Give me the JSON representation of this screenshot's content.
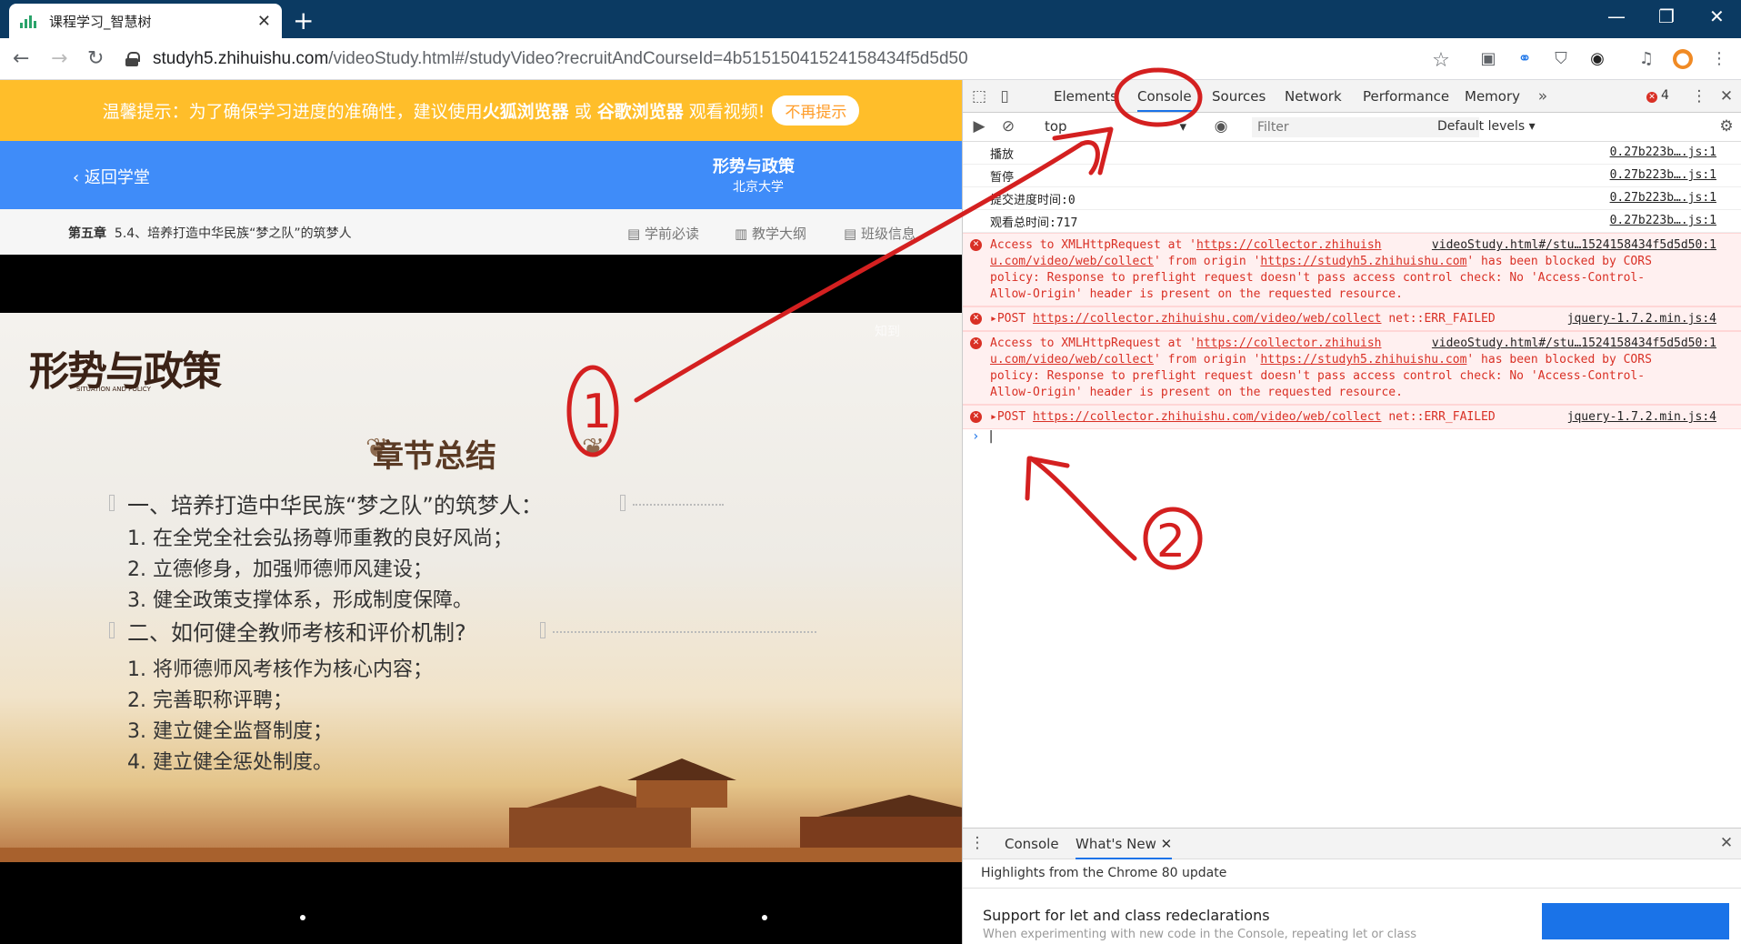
{
  "browser": {
    "tab_title": "课程学习_智慧树",
    "url_host": "studyh5.zhihuishu.com",
    "url_path": "/videoStudy.html#/studyVideo?recruitAndCourseId=4b51515041524158434f5d5d50"
  },
  "notice": {
    "text_prefix": "温馨提示：为了确保学习进度的准确性，建议使用",
    "browser1": "火狐浏览器",
    "or": "或",
    "browser2": "谷歌浏览器",
    "suffix": "观看视频!",
    "dismiss": "不再提示"
  },
  "course": {
    "back": "返回学堂",
    "title": "形势与政策",
    "university": "北京大学"
  },
  "chapter": {
    "label": "第五章",
    "text": "5.4、培养打造中华民族“梦之队”的筑梦人",
    "links": [
      "学前必读",
      "教学大纲",
      "班级信息"
    ]
  },
  "slide": {
    "logo": "形势与政策",
    "logo_sub": "SITUATION AND POLICY",
    "watermark": "知到",
    "heading": "章节总结",
    "sections": [
      {
        "title": "一、培养打造中华民族“梦之队”的筑梦人：",
        "items": [
          "1.  在全党全社会弘扬尊师重教的良好风尚；",
          "2.  立德修身，加强师德师风建设；",
          "3.  健全政策支撑体系，形成制度保障。"
        ]
      },
      {
        "title": "二、如何健全教师考核和评价机制?",
        "items": [
          "1.  将师德师风考核作为核心内容；",
          "2.  完善职称评聘；",
          "3.  建立健全监督制度；",
          "4.  建立健全惩处制度。"
        ]
      }
    ]
  },
  "devtools": {
    "tabs": [
      "Elements",
      "Console",
      "Sources",
      "Network",
      "Performance",
      "Memory"
    ],
    "error_count": "4",
    "context": "top",
    "filter_placeholder": "Filter",
    "levels": "Default levels",
    "logs": [
      {
        "text": "播放",
        "src": "0.27b223b….js:1"
      },
      {
        "text": "暂停",
        "src": "0.27b223b….js:1"
      },
      {
        "text": "提交进度时间:0",
        "src": "0.27b223b….js:1"
      },
      {
        "text": "观看总时间:717",
        "src": "0.27b223b….js:1"
      }
    ],
    "errors": [
      {
        "type": "cors",
        "l1a": "Access to XMLHttpRequest at '",
        "l1link": "https://collector.zhihuish",
        "src": "videoStudy.html#/stu…1524158434f5d5d50:1",
        "l2link": "u.com/video/web/collect",
        "l2b": "' from origin '",
        "origin": "https://studyh5.zhihuishu.com",
        "l2c": "' has been blocked by CORS",
        "l3": "policy: Response to preflight request doesn't pass access control check: No 'Access-Control-",
        "l4": "Allow-Origin' header is present on the requested resource."
      },
      {
        "type": "post",
        "method": "▸POST",
        "url": "https://collector.zhihuishu.com/video/web/collect",
        "status": "net::ERR_FAILED",
        "src": "jquery-1.7.2.min.js:4"
      },
      {
        "type": "cors",
        "l1a": "Access to XMLHttpRequest at '",
        "l1link": "https://collector.zhihuish",
        "src": "videoStudy.html#/stu…1524158434f5d5d50:1",
        "l2link": "u.com/video/web/collect",
        "l2b": "' from origin '",
        "origin": "https://studyh5.zhihuishu.com",
        "l2c": "' has been blocked by CORS",
        "l3": "policy: Response to preflight request doesn't pass access control check: No 'Access-Control-",
        "l4": "Allow-Origin' header is present on the requested resource."
      },
      {
        "type": "post",
        "method": "▸POST",
        "url": "https://collector.zhihuishu.com/video/web/collect",
        "status": "net::ERR_FAILED",
        "src": "jquery-1.7.2.min.js:4"
      }
    ],
    "drawer": {
      "tabs": [
        "Console",
        "What's New"
      ],
      "header": "Highlights from the Chrome 80 update",
      "item_title": "Support for let and class redeclarations",
      "item_sub": "When experimenting with new code in the Console, repeating let or class"
    }
  },
  "annotations": {
    "mark1": "1",
    "mark2": "2",
    "color": "#d42020"
  },
  "colors": {
    "notice": "#ffbe2a",
    "course_bar": "#3f8cf9",
    "browser_frame": "#0b3a62",
    "error_text": "#d93025",
    "devtools_accent": "#1a73e8"
  }
}
